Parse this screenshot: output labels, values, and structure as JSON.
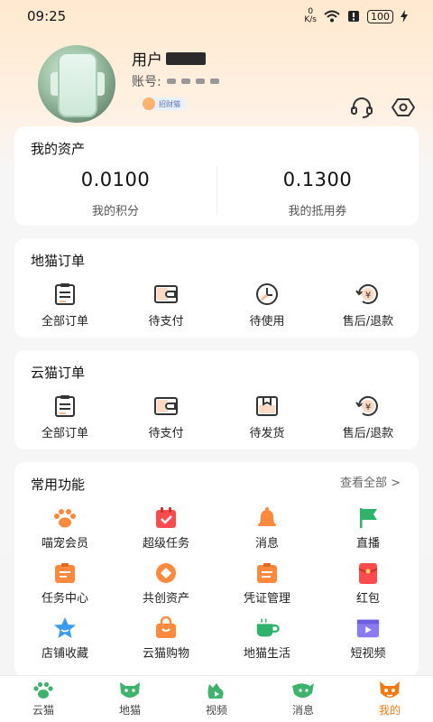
{
  "status": {
    "time": "09:25",
    "speed_top": "0",
    "speed_unit": "K/s",
    "battery": "100"
  },
  "profile": {
    "username_prefix": "用户",
    "account_label": "账号:",
    "badge": "招财猫"
  },
  "assets": {
    "title": "我的资产",
    "items": [
      {
        "value": "0.0100",
        "label": "我的积分"
      },
      {
        "value": "0.1300",
        "label": "我的抵用券"
      }
    ]
  },
  "dimao_orders": {
    "title": "地猫订单",
    "items": [
      {
        "label": "全部订单",
        "icon": "clipboard-icon"
      },
      {
        "label": "待支付",
        "icon": "wallet-icon"
      },
      {
        "label": "待使用",
        "icon": "clock-icon"
      },
      {
        "label": "售后/退款",
        "icon": "refund-icon"
      }
    ]
  },
  "yunmao_orders": {
    "title": "云猫订单",
    "items": [
      {
        "label": "全部订单",
        "icon": "clipboard-icon"
      },
      {
        "label": "待支付",
        "icon": "wallet-icon"
      },
      {
        "label": "待发货",
        "icon": "package-icon"
      },
      {
        "label": "售后/退款",
        "icon": "refund-icon"
      }
    ]
  },
  "features": {
    "title": "常用功能",
    "view_all": "查看全部 >",
    "items": [
      {
        "label": "喵宠会员",
        "icon": "paw-icon",
        "color": "#ff8a3d"
      },
      {
        "label": "超级任务",
        "icon": "calendar-check-icon",
        "color": "#ff4b4b"
      },
      {
        "label": "消息",
        "icon": "bell-icon",
        "color": "#ff8a3d"
      },
      {
        "label": "直播",
        "icon": "flag-icon",
        "color": "#2fb36a"
      },
      {
        "label": "任务中心",
        "icon": "task-card-icon",
        "color": "#ff8a3d"
      },
      {
        "label": "共创资产",
        "icon": "diamond-coin-icon",
        "color": "#ff8a3d"
      },
      {
        "label": "凭证管理",
        "icon": "voucher-card-icon",
        "color": "#ff8a3d"
      },
      {
        "label": "红包",
        "icon": "red-envelope-icon",
        "color": "#ff4b4b"
      },
      {
        "label": "店铺收藏",
        "icon": "star-icon",
        "color": "#3a9cf0"
      },
      {
        "label": "云猫购物",
        "icon": "shopping-bag-icon",
        "color": "#ff8a3d"
      },
      {
        "label": "地猫生活",
        "icon": "coffee-cup-icon",
        "color": "#2fb36a"
      },
      {
        "label": "短视频",
        "icon": "video-icon",
        "color": "#8a7cf0"
      }
    ]
  },
  "tabs": [
    {
      "label": "云猫",
      "icon": "paw-tab-icon",
      "active": false
    },
    {
      "label": "地猫",
      "icon": "cat-tab-icon",
      "active": false
    },
    {
      "label": "视频",
      "icon": "video-cat-tab-icon",
      "active": false
    },
    {
      "label": "消息",
      "icon": "message-cat-tab-icon",
      "active": false
    },
    {
      "label": "我的",
      "icon": "me-cat-tab-icon",
      "active": true
    }
  ],
  "colors": {
    "accent": "#f07a12",
    "icon_stroke": "#333333",
    "icon_fill": "#ffb98a"
  }
}
